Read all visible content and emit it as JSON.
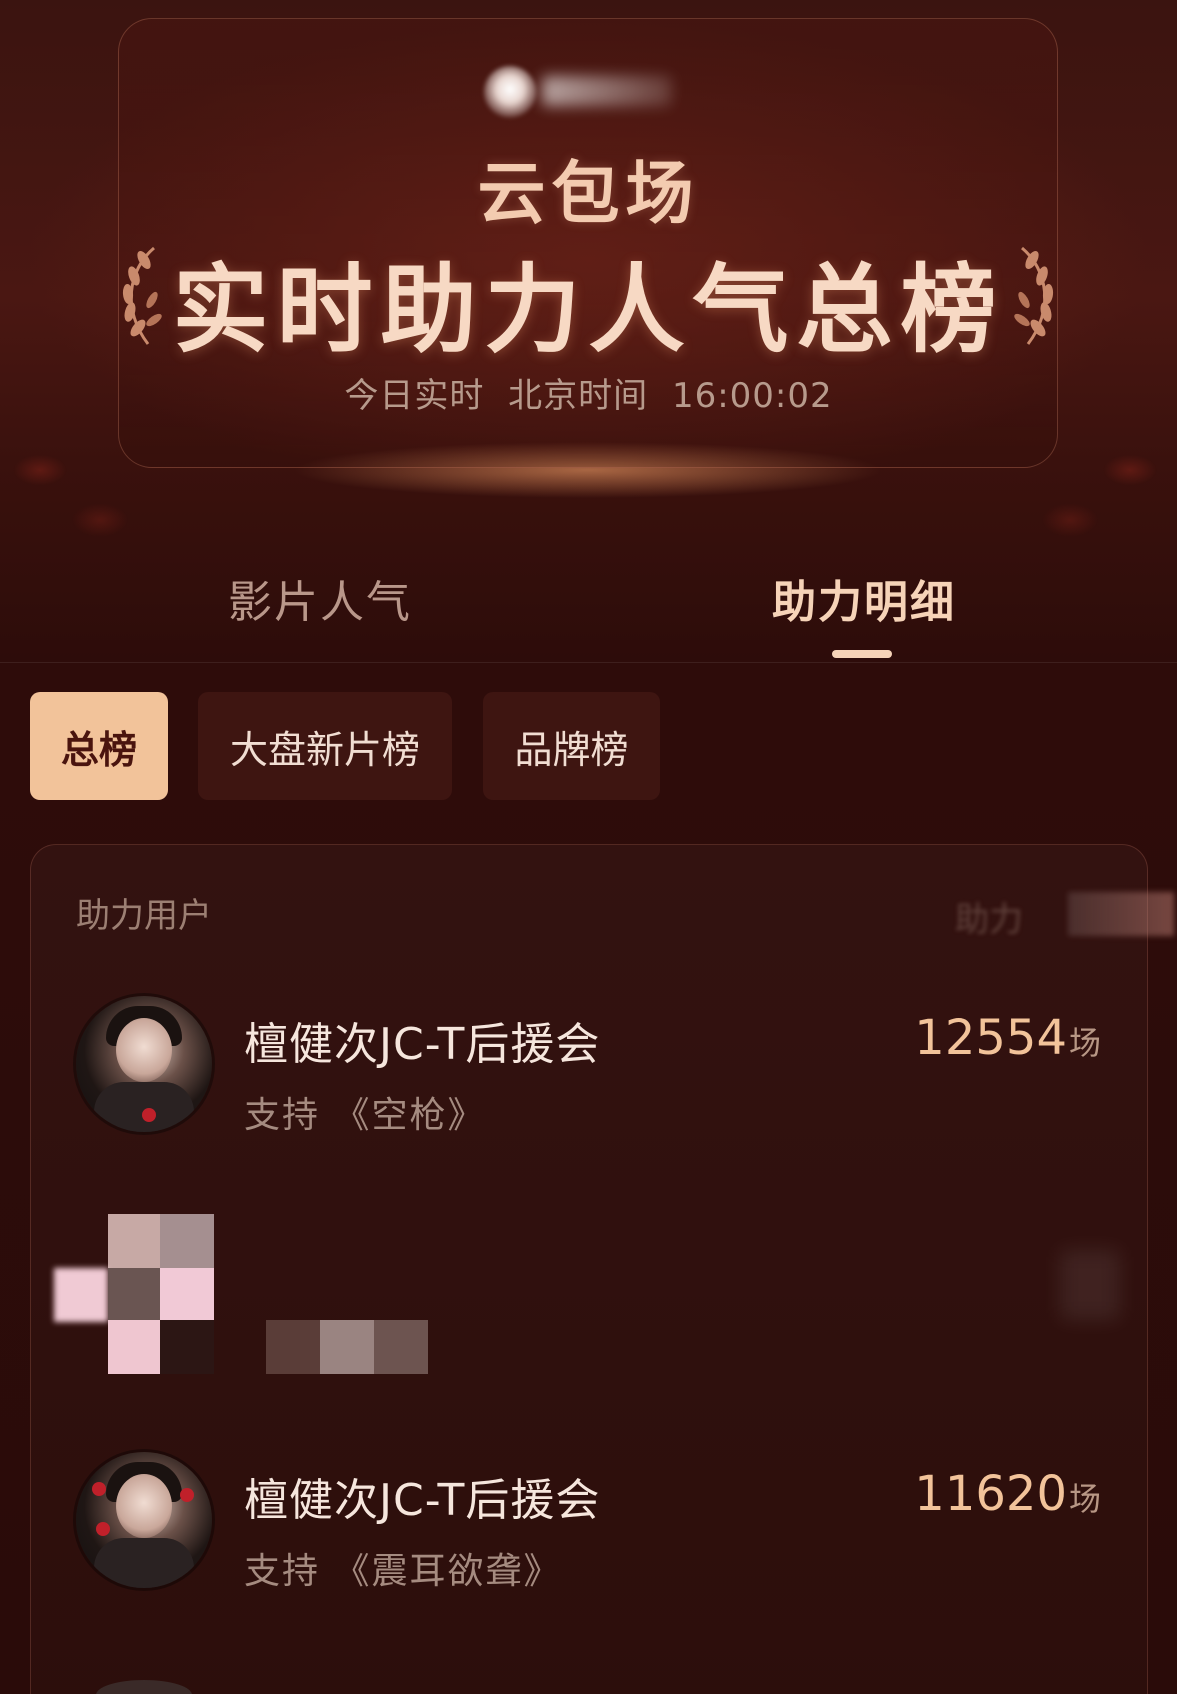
{
  "hero": {
    "subtitle": "云包场",
    "title": "实时助力人气总榜",
    "time_label": "今日实时",
    "timezone_label": "北京时间",
    "time_value": "16:00:02"
  },
  "main_tabs": [
    {
      "label": "影片人气",
      "active": false
    },
    {
      "label": "助力明细",
      "active": true
    }
  ],
  "filters": [
    {
      "label": "总榜",
      "active": true
    },
    {
      "label": "大盘新片榜",
      "active": false
    },
    {
      "label": "品牌榜",
      "active": false
    }
  ],
  "list": {
    "header_left": "助力用户",
    "header_right": "助力",
    "rows": [
      {
        "name": "檀健次JC-T后援会",
        "support_prefix": "支持",
        "movie": "《空枪》",
        "value": "12554",
        "unit": "场"
      },
      {
        "name": "",
        "support_prefix": "",
        "movie": "",
        "value": "",
        "unit": ""
      },
      {
        "name": "檀健次JC-T后援会",
        "support_prefix": "支持",
        "movie": "《震耳欲聋》",
        "value": "11620",
        "unit": "场"
      }
    ]
  },
  "colors": {
    "accent": "#f2c39a",
    "background": "#2a0b09",
    "active_tab": "#f6d3b8"
  }
}
